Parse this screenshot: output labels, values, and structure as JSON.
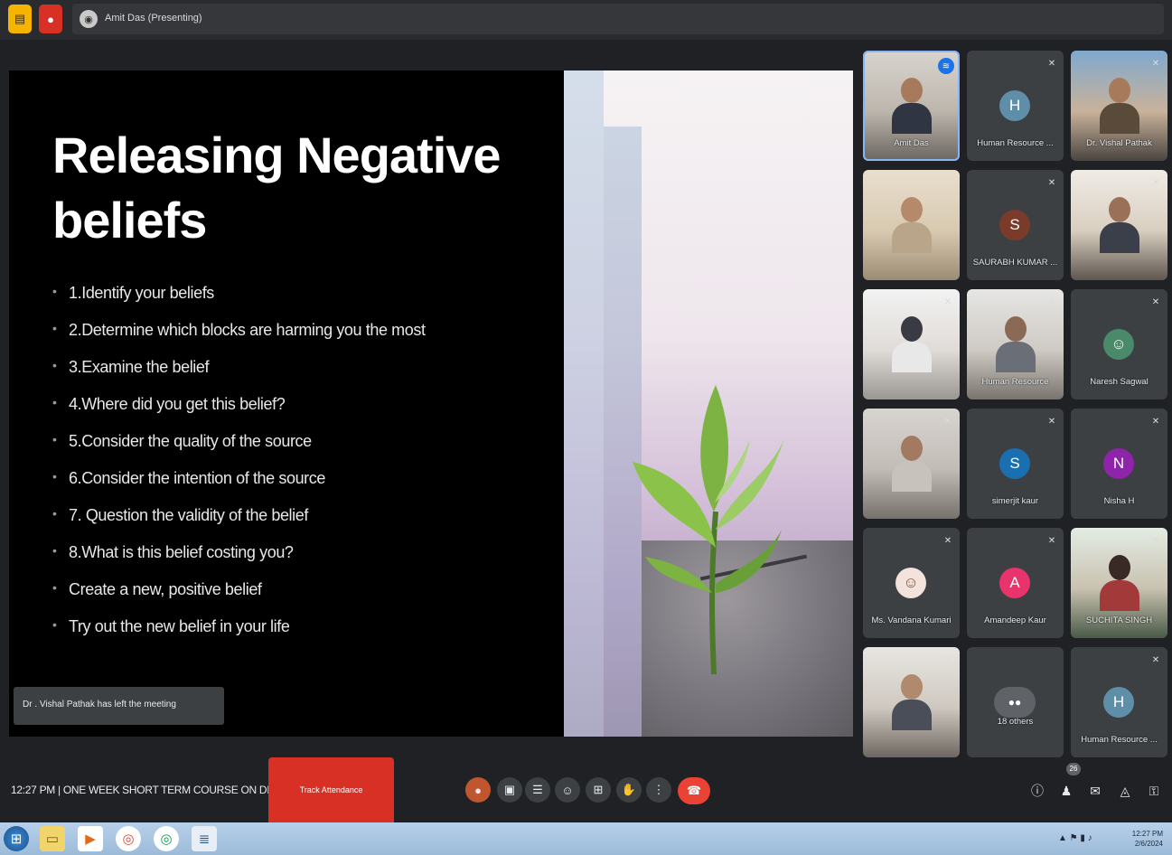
{
  "meeting": {
    "presenter_label": "Amit Das (Presenting)",
    "time": "12:27 PM",
    "title": "ONE WEEK SHORT TERM COURSE ON DIGIT...",
    "attendance_button": "Track Attendance",
    "participant_count": "26"
  },
  "slide": {
    "title": "Releasing Negative beliefs",
    "bullets": [
      "1.Identify your beliefs",
      "2.Determine which blocks are harming you the most",
      "3.Examine the belief",
      "4.Where did you get this belief?",
      "5.Consider the quality of the source",
      "6.Consider the intention of the source",
      "7. Question the validity of the belief",
      "8.What is this belief costing you?",
      "Create a new, positive belief",
      "Try out the new belief in your life"
    ]
  },
  "notice": "Dr . Vishal Pathak has left the meeting",
  "participants": [
    {
      "name": "Amit Das",
      "initial": "",
      "video": true,
      "speaking": true
    },
    {
      "name": "Human Resource ...",
      "initial": "H",
      "color": "#5f8fa8",
      "video": false
    },
    {
      "name": "Dr. Vishal Pathak",
      "initial": "",
      "video": true
    },
    {
      "name": "",
      "initial": "",
      "video": true
    },
    {
      "name": "SAURABH KUMAR ...",
      "initial": "S",
      "color": "#7a3b2a",
      "video": false
    },
    {
      "name": "",
      "initial": "",
      "video": true
    },
    {
      "name": "",
      "initial": "",
      "video": true
    },
    {
      "name": "Human Resource",
      "initial": "",
      "video": true
    },
    {
      "name": "Naresh Sagwal",
      "initial": "",
      "color": "#4a8a6a",
      "video": false
    },
    {
      "name": "",
      "initial": "",
      "video": true
    },
    {
      "name": "simerjit kaur",
      "initial": "S",
      "color": "#1a6fb0",
      "video": false
    },
    {
      "name": "Nisha H",
      "initial": "N",
      "color": "#8e24aa",
      "video": false
    },
    {
      "name": "Ms. Vandana Kumari",
      "initial": "",
      "color": "#d8a49a",
      "video": false
    },
    {
      "name": "Amandeep Kaur",
      "initial": "A",
      "color": "#e8336d",
      "video": false
    },
    {
      "name": "SUCHITA SINGH",
      "initial": "",
      "video": true
    },
    {
      "name": "",
      "initial": "",
      "video": true
    },
    {
      "name": "18 others",
      "initial": "",
      "color": "#5f6368",
      "video": false
    },
    {
      "name": "Human Resource ...",
      "initial": "H",
      "color": "#5f8fa8",
      "video": false
    }
  ],
  "controls": {
    "left": [
      "avatar-reaction",
      "camera",
      "captions",
      "emoji",
      "present",
      "raise-hand",
      "more"
    ],
    "end_call": "end-call",
    "right": [
      "info",
      "people",
      "chat",
      "activities",
      "lock"
    ]
  },
  "taskbar": {
    "clock_time": "12:27 PM",
    "clock_date": "2/6/2024"
  },
  "colors": {
    "background": "#202124",
    "tile": "#3c4043",
    "end_call": "#ea4335",
    "attendance": "#d93025",
    "speaking_ring": "#8ab4f8"
  }
}
